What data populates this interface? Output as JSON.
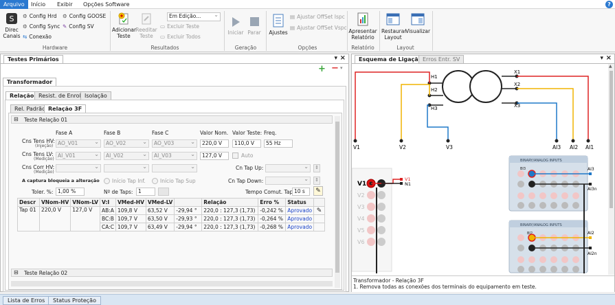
{
  "menu": {
    "items": [
      "Arquivo",
      "Início",
      "Exibir",
      "Opções Software"
    ]
  },
  "ribbon": {
    "hardware": {
      "direc": "Direc\nCanais",
      "config_hrd": "Config Hrd",
      "config_sync": "Config Sync",
      "conexao": "Conexão",
      "config_goose": "Config GOOSE",
      "config_sv": "Config SV",
      "label": "Hardware"
    },
    "resultados": {
      "adicionar": "Adicionar\nTeste",
      "reeditar": "Reeditar\nTeste",
      "status_select": "Em Edição...",
      "excluir_teste": "Excluir Teste",
      "excluir_todos": "Excluir Todos",
      "label": "Resultados"
    },
    "geracao": {
      "iniciar": "Iniciar",
      "parar": "Parar",
      "label": "Geração"
    },
    "opcoes": {
      "ajustes": "Ajustes",
      "ajustar_ispc": "Ajustar OffSet Ispc",
      "ajustar_vspc": "Ajustar OffSet Vspc",
      "label": "Opções"
    },
    "relatorio": {
      "apresentar": "Apresentar\nRelatório",
      "label": "Relatório"
    },
    "layout": {
      "restaurar": "Restaurar\nLayout",
      "visualizar": "Visualizar",
      "label": "Layout"
    }
  },
  "left": {
    "panel_title": "Testes Primários",
    "tab_main": "Transformador",
    "subtabs": [
      "Relação",
      "Resist. de Enrol.",
      "Isolação"
    ],
    "subsubtabs": [
      "Rel. Padrão",
      "Relação 3F"
    ],
    "test1": {
      "title": "Teste Relação 01",
      "headers": [
        "Fase A",
        "Fase B",
        "Fase C",
        "Valor Nom.",
        "Valor Teste:",
        "Freq."
      ],
      "row_hv_label": "Cns Tens HV:",
      "row_hv_sub": "(Injeção)",
      "row_lv_label": "Cns Tens LV:",
      "row_lv_sub": "(Medição)",
      "row_chv_label": "Cns Corr HV:",
      "row_chv_sub": "(Medição)",
      "hv": [
        "AO_V01",
        "AO_V02",
        "AO_V03"
      ],
      "lv": [
        "AI_V01",
        "AI_V02",
        "AI_V03"
      ],
      "valor_nom_hv": "220,0 V",
      "valor_teste_hv": "110,0 V",
      "freq": "55 Hz",
      "valor_nom_lv": "127,0 V",
      "auto": "Auto",
      "tap_up": "Cn Tap Up:",
      "tap_down": "Cn Tap Down:",
      "warn": "A captura bloqueia a alteração",
      "inicio_tap_inf": "Início Tap Inf.",
      "inicio_tap_sup": "Início Tap Sup",
      "toler_label": "Toler. %:",
      "toler": "1,00 %",
      "ntaps_label": "Nº de Taps:",
      "ntaps": "1",
      "tempo_label": "Tempo Comut. Tap",
      "tempo": "10 s",
      "table": {
        "headers": [
          "Descr",
          "VNom-HV",
          "VNom-LV",
          "V:I",
          "VMed-HV",
          "VMed-LV",
          "",
          "Relação",
          "Erro %",
          "Status"
        ],
        "descr": "Tap 01",
        "vnom_hv": "220,0 V",
        "vnom_lv": "127,0 V",
        "rows": [
          [
            "AB:A",
            "109,8 V",
            "63,52 V",
            "-29,94 °",
            "220,0 : 127,3 (1,73)",
            "-0,242 %",
            "Aprovado"
          ],
          [
            "BC:B",
            "109,7 V",
            "63,50 V",
            "-29,93 °",
            "220,0 : 127,3 (1,73)",
            "-0,264 %",
            "Aprovado"
          ],
          [
            "CA:C",
            "109,7 V",
            "63,49 V",
            "-29,94 °",
            "220,0 : 127,3 (1,73)",
            "-0,268 %",
            "Aprovado"
          ]
        ]
      }
    },
    "test2_title": "Teste Relação 02"
  },
  "right": {
    "tabs": [
      "Esquema de Ligação",
      "Erros Entr. SV"
    ],
    "terminals": {
      "h1": "H1",
      "h2": "H2",
      "h3": "H3",
      "x1": "X1",
      "x2": "X2",
      "x3": "X3"
    },
    "bottom_labels": [
      "V1",
      "V2",
      "V3",
      "AI3",
      "AI2",
      "AI1"
    ],
    "v_outputs": [
      "V1",
      "V2",
      "V3",
      "V4",
      "V5",
      "V6"
    ],
    "v1_tag": "V1",
    "n1_tag": "N1",
    "binary_title": "BINARY/ANALOG INPUTS",
    "bi3": "BI3",
    "bi2": "BI2",
    "ai3": "AI3",
    "ai3n": "AI3n",
    "ai2": "AI2",
    "ai2n": "AI2n",
    "status_line1": "Transformador - Relação 3F",
    "status_line2": "1. Remova todas as conexões dos terminais do equipamento em teste."
  },
  "bottom_tabs": [
    "Lista de Erros",
    "Status Proteção"
  ]
}
